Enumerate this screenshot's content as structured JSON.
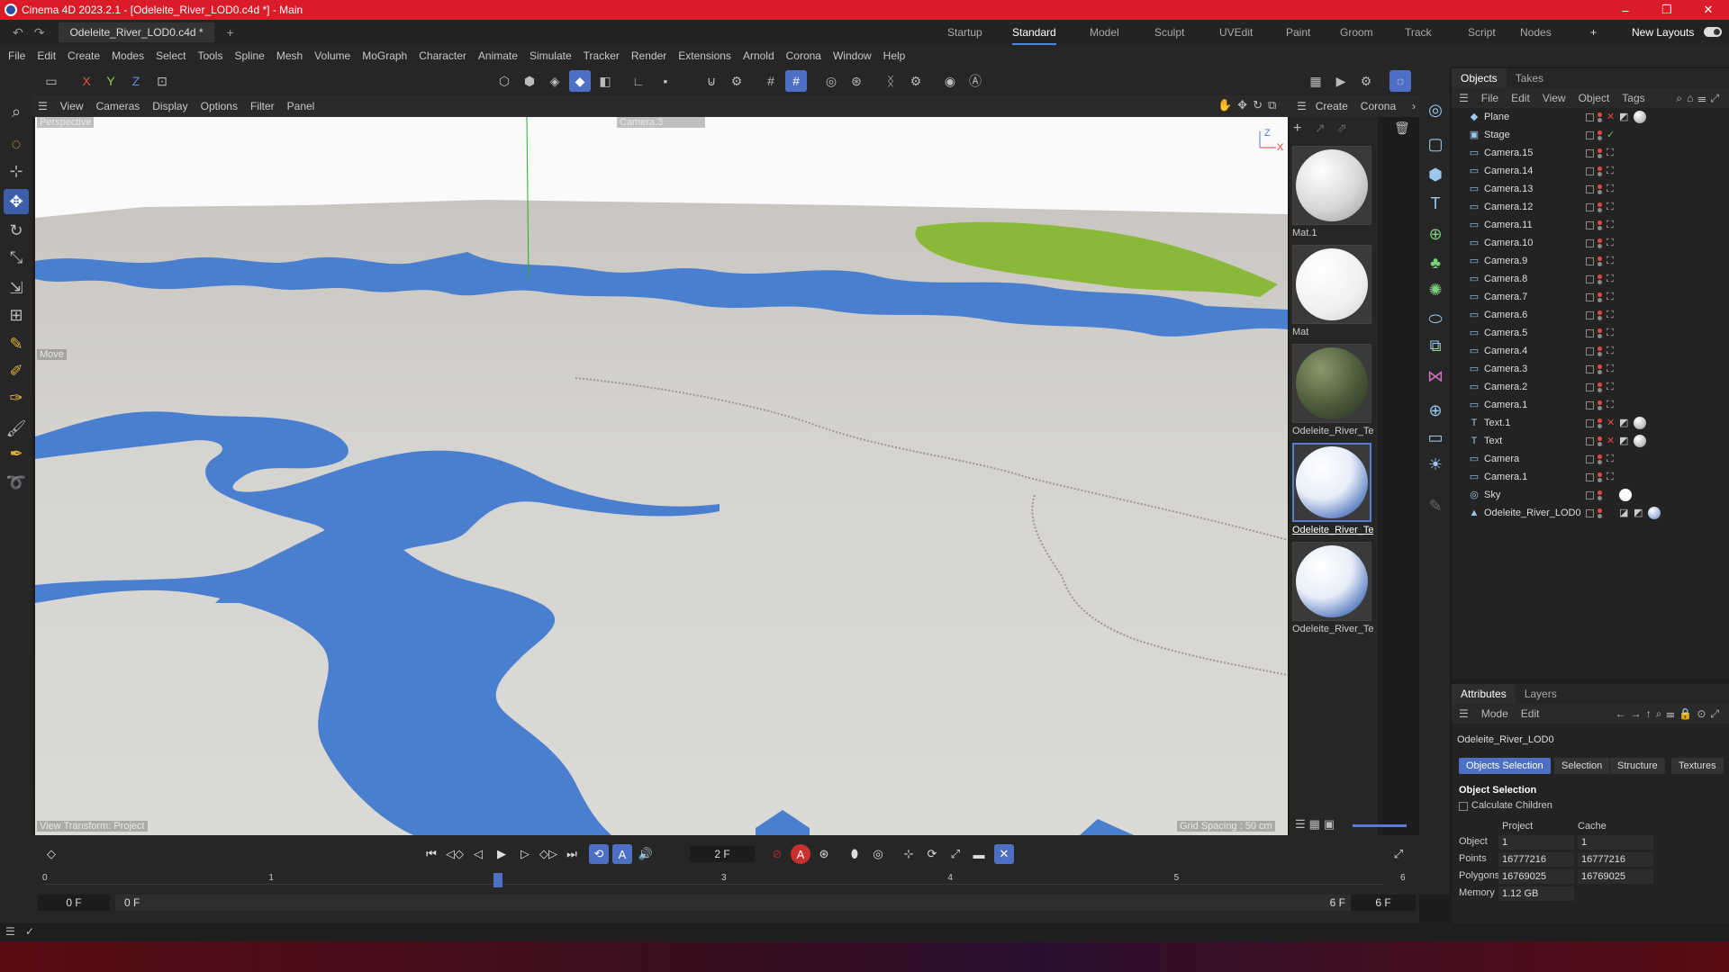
{
  "window": {
    "title": "Cinema 4D 2023.2.1 - [Odeleite_River_LOD0.c4d *] - Main",
    "minimize": "–",
    "maximize": "❐",
    "close": "✕"
  },
  "doc_tab": {
    "label": "Odeleite_River_LOD0.c4d *",
    "close": "✕",
    "add": "+"
  },
  "layouts": [
    "Startup",
    "Standard",
    "Model",
    "Sculpt",
    "UVEdit",
    "Paint",
    "Groom",
    "Track",
    "Script",
    "Nodes"
  ],
  "layouts_selected": "Standard",
  "new_layouts": "New Layouts",
  "add_layout": "+",
  "menu": [
    "File",
    "Edit",
    "Create",
    "Modes",
    "Select",
    "Tools",
    "Spline",
    "Mesh",
    "Volume",
    "MoGraph",
    "Character",
    "Animate",
    "Simulate",
    "Tracker",
    "Render",
    "Extensions",
    "Arnold",
    "Corona",
    "Window",
    "Help"
  ],
  "axes": {
    "x": "X",
    "y": "Y",
    "z": "Z"
  },
  "viewport": {
    "menu": [
      "View",
      "Cameras",
      "Display",
      "Options",
      "Filter",
      "Panel"
    ],
    "label_top_left": "Perspective",
    "label_camera": "Camera.3",
    "label_move": "Move",
    "label_bottom_left": "View Transform: Project",
    "label_bottom_right": "Grid Spacing : 50 cm",
    "axis_z": "Z",
    "axis_x": "X",
    "colors": {
      "terrain": "#d8d6d2",
      "water": "#4a7fd0",
      "vegetation": "#8ab838",
      "sky": "#fafafa"
    }
  },
  "materials_panel": {
    "menu": [
      "Create",
      "Corona"
    ],
    "items": [
      {
        "name": "Mat.1",
        "kind": "white-textured"
      },
      {
        "name": "Mat",
        "kind": "white"
      },
      {
        "name": "Odeleite_River_Te:",
        "kind": "river-dark"
      },
      {
        "name": "Odeleite_River_Te:",
        "kind": "river-light",
        "selected": true
      },
      {
        "name": "Odeleite_River_Te:",
        "kind": "river-light"
      }
    ]
  },
  "objects_panel": {
    "tabs": [
      "Objects",
      "Takes"
    ],
    "menu": [
      "File",
      "Edit",
      "View",
      "Object",
      "Tags"
    ],
    "items": [
      {
        "name": "Plane",
        "icon": "plane-icon",
        "tag": "x"
      },
      {
        "name": "Stage",
        "icon": "stage-icon",
        "tag": "check"
      },
      {
        "name": "Camera.15",
        "icon": "camera-icon"
      },
      {
        "name": "Camera.14",
        "icon": "camera-icon"
      },
      {
        "name": "Camera.13",
        "icon": "camera-icon"
      },
      {
        "name": "Camera.12",
        "icon": "camera-icon"
      },
      {
        "name": "Camera.11",
        "icon": "camera-icon"
      },
      {
        "name": "Camera.10",
        "icon": "camera-icon"
      },
      {
        "name": "Camera.9",
        "icon": "camera-icon"
      },
      {
        "name": "Camera.8",
        "icon": "camera-icon"
      },
      {
        "name": "Camera.7",
        "icon": "camera-icon"
      },
      {
        "name": "Camera.6",
        "icon": "camera-icon"
      },
      {
        "name": "Camera.5",
        "icon": "camera-icon"
      },
      {
        "name": "Camera.4",
        "icon": "camera-icon"
      },
      {
        "name": "Camera.3",
        "icon": "camera-icon"
      },
      {
        "name": "Camera.2",
        "icon": "camera-icon"
      },
      {
        "name": "Camera.1",
        "icon": "camera-icon"
      },
      {
        "name": "Text.1",
        "icon": "text-icon",
        "tag": "x"
      },
      {
        "name": "Text",
        "icon": "text-icon",
        "tag": "x"
      },
      {
        "name": "Camera",
        "icon": "camera-icon"
      },
      {
        "name": "Camera.1",
        "icon": "camera-icon"
      },
      {
        "name": "Sky",
        "icon": "sky-icon"
      },
      {
        "name": "Odeleite_River_LOD0",
        "icon": "mesh-icon"
      }
    ]
  },
  "attributes_panel": {
    "tabs": [
      "Attributes",
      "Layers"
    ],
    "menu": [
      "Mode",
      "Edit"
    ],
    "object_name": "Odeleite_River_LOD0",
    "subtabs": [
      "Objects Selection",
      "Selection",
      "Structure",
      "Textures"
    ],
    "section": "Object Selection",
    "calc_children": "Calculate Children",
    "columns": [
      "Project",
      "Cache"
    ],
    "rows": [
      {
        "label": "Object",
        "project": "1",
        "cache": "1"
      },
      {
        "label": "Points",
        "project": "16777216",
        "cache": "16777216"
      },
      {
        "label": "Polygons",
        "project": "16769025",
        "cache": "16769025"
      },
      {
        "label": "Memory",
        "project": "1.12 GB",
        "cache": ""
      }
    ]
  },
  "timeline": {
    "current_frame": "2 F",
    "ticks": [
      "0",
      "1",
      "2",
      "3",
      "4",
      "5",
      "6"
    ],
    "playhead_frame": 2,
    "total_frames": 6,
    "start_field": "0 F",
    "start_field2": "0 F",
    "end_field": "6 F",
    "end_field2": "6 F"
  }
}
